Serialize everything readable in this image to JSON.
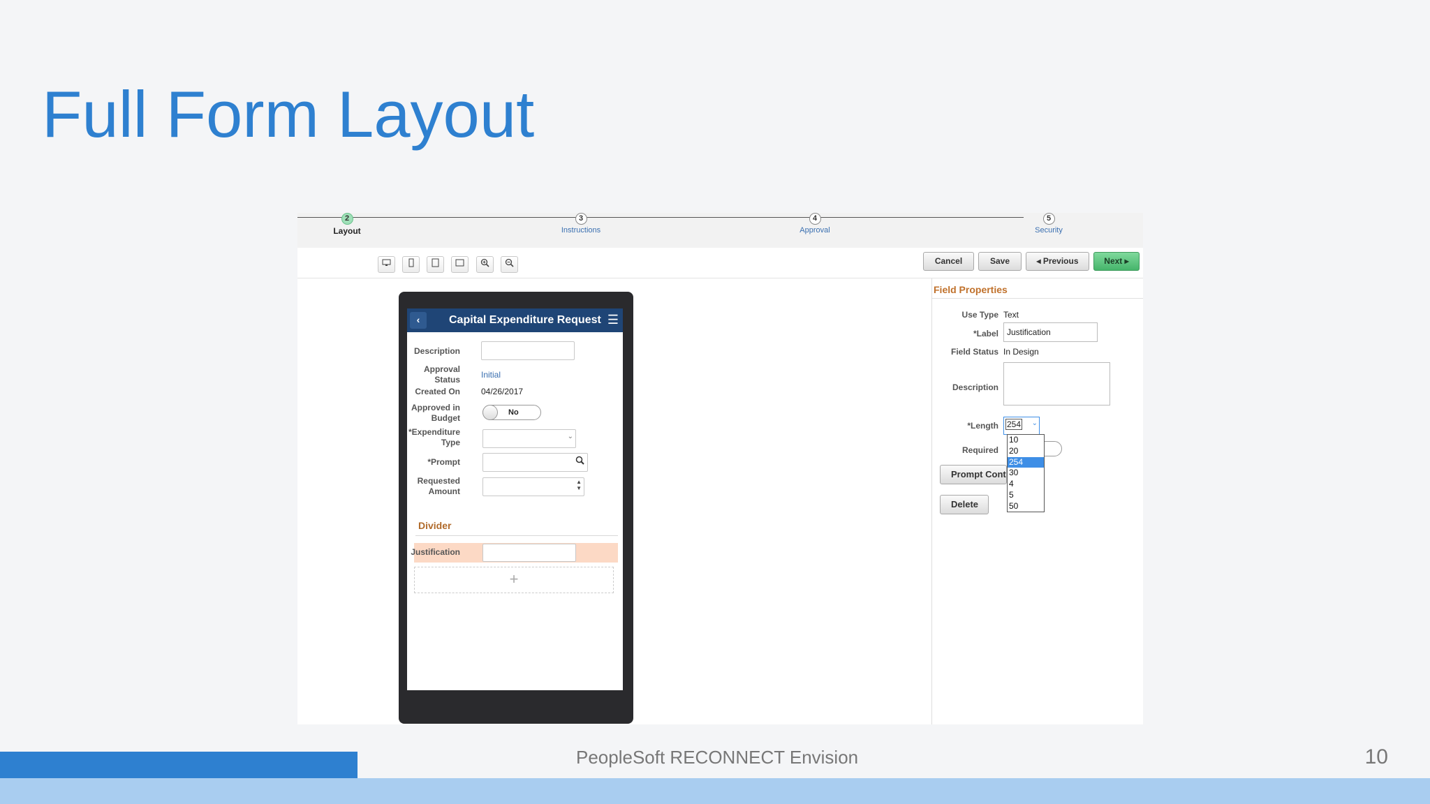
{
  "slide": {
    "title": "Full Form Layout",
    "footer": "PeopleSoft RECONNECT Envision",
    "page_number": "10"
  },
  "steps": [
    {
      "number": "2",
      "label": "Layout",
      "active": true
    },
    {
      "number": "3",
      "label": "Instructions",
      "active": false
    },
    {
      "number": "4",
      "label": "Approval",
      "active": false
    },
    {
      "number": "5",
      "label": "Security",
      "active": false
    }
  ],
  "toolbar": {
    "icons": [
      "desktop-icon",
      "phone-portrait-icon",
      "tablet-portrait-icon",
      "tablet-landscape-icon",
      "zoom-in-icon",
      "zoom-out-icon"
    ],
    "cancel": "Cancel",
    "save": "Save",
    "previous": "Previous",
    "next": "Next"
  },
  "phone": {
    "title": "Capital Expenditure Request",
    "fields": {
      "description_label": "Description",
      "approval_status_label_1": "Approval",
      "approval_status_label_2": "Status",
      "approval_status_value": "Initial",
      "created_on_label": "Created On",
      "created_on_value": "04/26/2017",
      "approved_label_1": "Approved in",
      "approved_label_2": "Budget",
      "approved_value": "No",
      "expenditure_label_1": "*Expenditure",
      "expenditure_label_2": "Type",
      "prompt_label": "*Prompt",
      "requested_label_1": "Requested",
      "requested_label_2": "Amount",
      "divider": "Divider",
      "justification_label": "Justification",
      "add_symbol": "+"
    }
  },
  "field_properties": {
    "title": "Field Properties",
    "use_type_label": "Use Type",
    "use_type_value": "Text",
    "label_label": "*Label",
    "label_value": "Justification",
    "field_status_label": "Field Status",
    "field_status_value": "In Design",
    "description_label": "Description",
    "length_label": "*Length",
    "length_value": "254",
    "required_label": "Required",
    "prompt_button": "Prompt Controls",
    "delete_button": "Delete",
    "length_options": [
      "10",
      "20",
      "254",
      "30",
      "4",
      "5",
      "50"
    ],
    "length_selected": "254"
  },
  "colors": {
    "title": "#2e80d0",
    "phone_header": "#1f4576",
    "accent_orange": "#c0712b",
    "next_button": "#46b56b"
  }
}
